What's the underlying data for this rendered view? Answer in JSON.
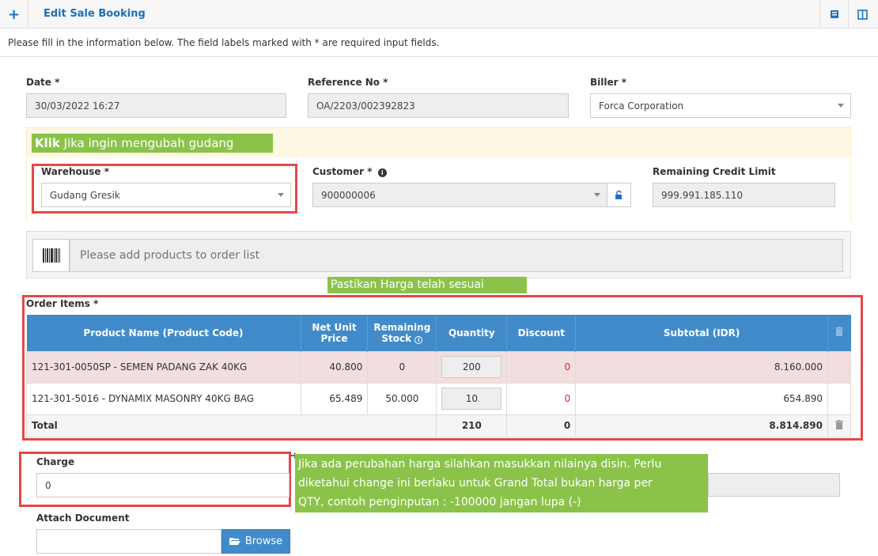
{
  "header": {
    "title": "Edit Sale Booking",
    "add_icon": "plus-icon",
    "btn1_icon": "book-icon",
    "btn2_icon": "columns-icon"
  },
  "intro_text": "Please fill in the information below. The field labels marked with * are required input fields.",
  "fields": {
    "date": {
      "label": "Date *",
      "value": "30/03/2022 16:27"
    },
    "reference": {
      "label": "Reference No *",
      "value": "OA/2203/002392823"
    },
    "biller": {
      "label": "Biller *",
      "value": "Forca Corporation"
    },
    "warehouse": {
      "label": "Warehouse *",
      "value": "Gudang Gresik"
    },
    "customer": {
      "label": "Customer *",
      "value": "900000006"
    },
    "credit_limit": {
      "label": "Remaining Credit Limit",
      "value": "999.991.185.110"
    },
    "product_search_placeholder": "Please add products to order list",
    "charge": {
      "label": "Charge",
      "value": "0"
    },
    "attach": {
      "label": "Attach Document",
      "browse_label": "Browse"
    }
  },
  "annotations": {
    "warehouse_note_bold": "Klik",
    "warehouse_note": "Jika ingin mengubah gudang",
    "price_note": "Pastikan Harga telah sesuai",
    "charge_note_1": "Jika ada perubahan harga silahkan masukkan nilainya disin. Perlu",
    "charge_note_2": "diketahui change ini berlaku untuk Grand Total bukan harga per",
    "charge_note_3": "QTY, contoh penginputan : -100000 jangan lupa (-)"
  },
  "order": {
    "label": "Order Items *",
    "columns": {
      "product": "Product Name (Product Code)",
      "price_1": "Net Unit",
      "price_2": "Price",
      "stock_1": "Remaining",
      "stock_2": "Stock",
      "qty": "Quantity",
      "discount": "Discount",
      "subtotal": "Subtotal (IDR)"
    },
    "rows": [
      {
        "product": "121-301-0050SP - SEMEN PADANG ZAK 40KG",
        "price": "40.800",
        "stock": "0",
        "qty": "200",
        "discount": "0",
        "subtotal": "8.160.000"
      },
      {
        "product": "121-301-5016 - DYNAMIX MASONRY 40KG BAG",
        "price": "65.489",
        "stock": "50.000",
        "qty": "10",
        "discount": "0",
        "subtotal": "654.890"
      }
    ],
    "total": {
      "label": "Total",
      "qty": "210",
      "discount": "0",
      "subtotal": "8.814.890"
    }
  },
  "colors": {
    "primary": "#428bca",
    "annotation_green": "#8bc34a",
    "annotation_red": "#e4484b",
    "row_warning": "#f2dede"
  }
}
